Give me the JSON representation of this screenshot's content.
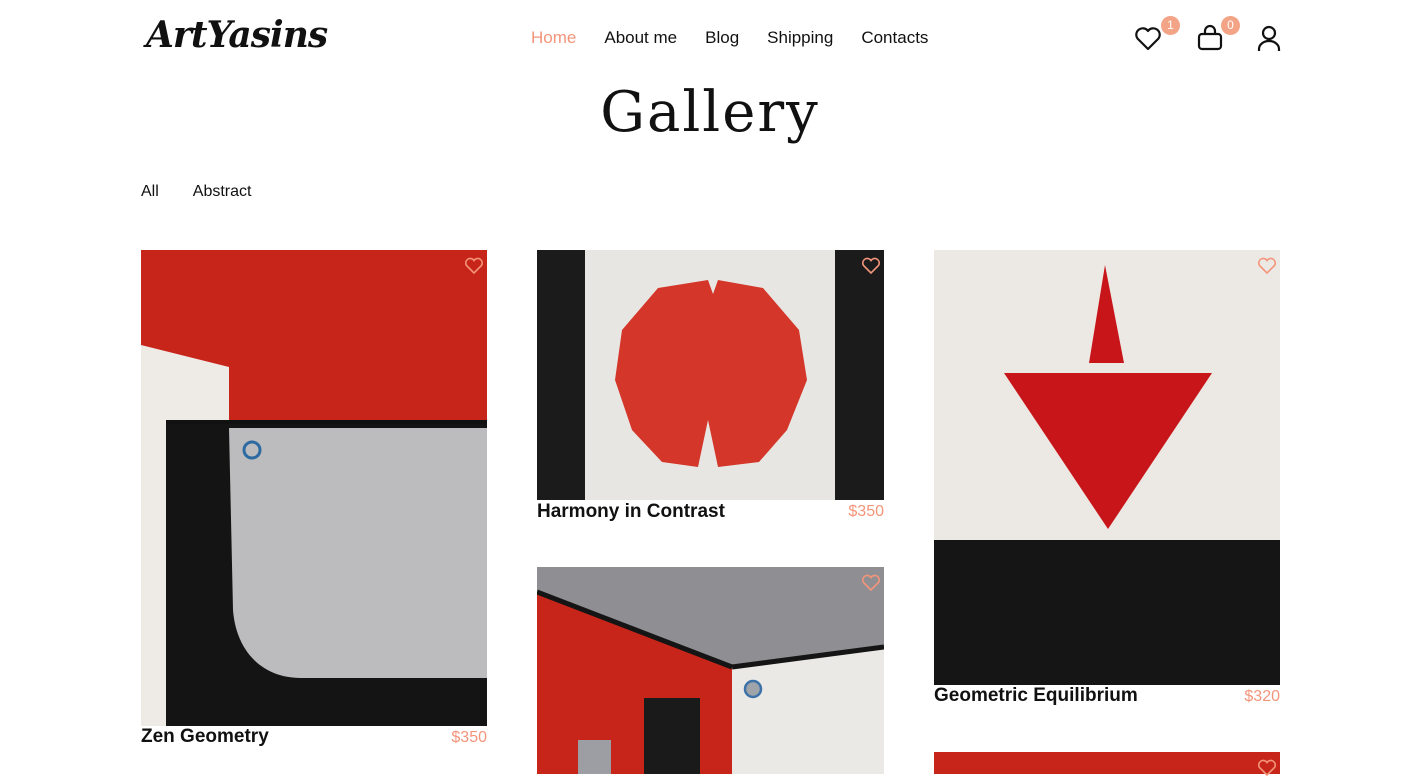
{
  "brand": {
    "logo": "ArtYasins"
  },
  "nav": {
    "items": [
      "Home",
      "About me",
      "Blog",
      "Shipping",
      "Contacts"
    ],
    "active": "Home"
  },
  "header_icons": {
    "favorites_count": "1",
    "cart_count": "0",
    "favorites_icon": "heart-icon",
    "cart_icon": "shopping-bag-icon",
    "account_icon": "user-icon"
  },
  "page": {
    "title": "Gallery"
  },
  "filters": [
    "All",
    "Abstract"
  ],
  "colors": {
    "accent": "#f3957a",
    "badge": "#f3a386",
    "paint_red": "#c8251a",
    "paint_black": "#111111",
    "paint_grey": "#b9babd"
  },
  "products": [
    {
      "name": "Zen Geometry",
      "price": "$350"
    },
    {
      "name": "Harmony in Contrast",
      "price": "$350"
    },
    {
      "name": "Geometric Equilibrium",
      "price": "$320"
    },
    {
      "name": "",
      "price": ""
    },
    {
      "name": "",
      "price": ""
    }
  ]
}
